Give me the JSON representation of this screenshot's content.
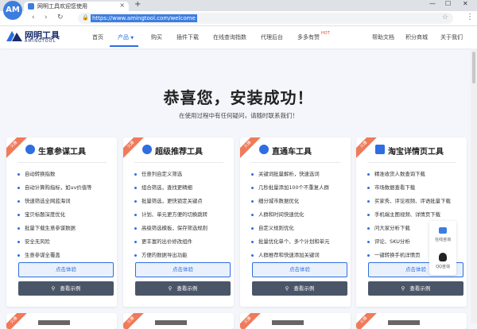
{
  "browser": {
    "tab_title": "网明工具欢迎您使用",
    "url": "https://www.amingtool.com/welcome",
    "new_tab": "+",
    "close": "×",
    "win_min": "—",
    "win_max": "☐",
    "win_close": "✕",
    "back": "‹",
    "forward": "›",
    "reload": "↻",
    "menu": "⋮",
    "star": "☆",
    "app_icon_text": "AM"
  },
  "site": {
    "logo_name": "网明工具",
    "logo_sub": "AMINGTOOL",
    "nav": {
      "home": "首页",
      "product": "产品",
      "buy": "购买",
      "plugin": "插件下载",
      "online": "在线查询指数",
      "agent": "代理后台",
      "earn": "多多有赞",
      "hot": "HOT",
      "help": "帮助文档",
      "points": "积分商城",
      "about": "关于我们"
    }
  },
  "hero": {
    "title": "恭喜您，安装成功！",
    "subtitle": "在使用过程中有任何疑问，请随时联系我们！"
  },
  "cards": [
    {
      "ribbon": "火爆",
      "title": "生意参谋工具",
      "icon_color": "#2d6ee0",
      "features": [
        "自动转换指数",
        "自动计算购指标，如uv价值等",
        "快速筛选全网蓝海词",
        "宝贝标题深度优化",
        "批量下载生意参谋数据",
        "安全无风险",
        "生意参谋全覆盖"
      ],
      "try": "点击体验",
      "demo": "查看示例"
    },
    {
      "ribbon": "火爆",
      "title": "超级推荐工具",
      "icon_color": "#2d6ee0",
      "features": [
        "任意列自定义筛选",
        "组合筛选，查找更精细",
        "批量筛选，更快锁定关键点",
        "计划、单元更方便的切换跳转",
        "高级筛选模板，保存筛选规则",
        "更丰富的出价修改组件",
        "方便的数据导出功能"
      ],
      "try": "点击体验",
      "demo": "查看示例"
    },
    {
      "ribbon": "火爆",
      "title": "直通车工具",
      "icon_color": "#2d6ee0",
      "features": [
        "关键词批量解析，快速选词",
        "几秒批量添加100个不重复人群",
        "细分城市数据优化",
        "人群和时间快速优化",
        "自定义规则优化",
        "批量优化单个、多个计划和单元",
        "人群推荐和快速添加关键词"
      ],
      "try": "点击体验",
      "demo": "查看示例"
    },
    {
      "ribbon": "火爆",
      "title": "淘宝详情页工具",
      "icon_color": "#2d6ee0",
      "features": [
        "精准收货人数查询下载",
        "市场数据查看下载",
        "买家秀、评论视频、评语批量下载",
        "手机端主图视频、详情页下载",
        "问大家分析下载",
        "评论、SKU分析",
        "一键转换手机详情页"
      ],
      "try": "点击体验",
      "demo": "查看示例"
    }
  ],
  "widget": {
    "online": "在线咨询",
    "qq": "QQ咨询"
  }
}
